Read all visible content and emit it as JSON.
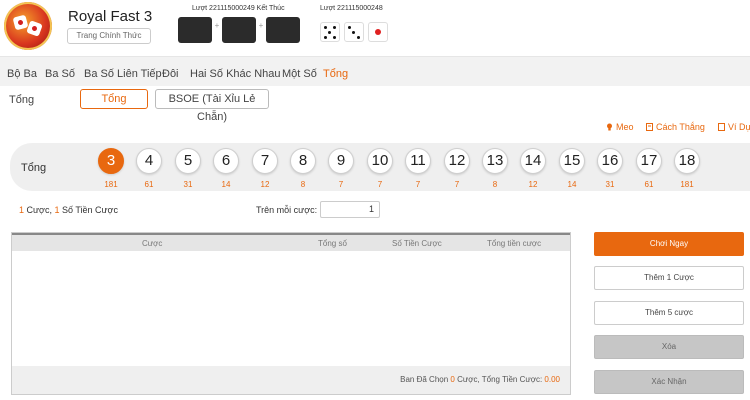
{
  "header": {
    "title": "Royal Fast 3",
    "home_button": "Trang Chính Thức",
    "result_label": "Lượt 221115000249 Kết Thúc",
    "next_label": "Lượt 221115000248",
    "logo_icon": "dice-logo-icon"
  },
  "tabs": [
    "Bộ Ba",
    "Ba Số",
    "Ba Số Liên Tiếp",
    "Đôi",
    "Hai Số Khác Nhau",
    "Một Số",
    "Tổng"
  ],
  "active_tab": "Tổng",
  "sub": {
    "label": "Tổng",
    "options": [
      "Tổng",
      "BSOE (Tài Xỉu Lẻ Chẵn)"
    ],
    "active": "Tổng"
  },
  "info_links": [
    "Meo",
    "Cách Thắng",
    "Ví Dụ"
  ],
  "numbers": {
    "label": "Tổng",
    "balls": [
      {
        "value": "3",
        "odds": "181"
      },
      {
        "value": "4",
        "odds": "61"
      },
      {
        "value": "5",
        "odds": "31"
      },
      {
        "value": "6",
        "odds": "14"
      },
      {
        "value": "7",
        "odds": "12"
      },
      {
        "value": "8",
        "odds": "8"
      },
      {
        "value": "9",
        "odds": "7"
      },
      {
        "value": "10",
        "odds": "7"
      },
      {
        "value": "11",
        "odds": "7"
      },
      {
        "value": "12",
        "odds": "7"
      },
      {
        "value": "13",
        "odds": "8"
      },
      {
        "value": "14",
        "odds": "12"
      },
      {
        "value": "15",
        "odds": "14"
      },
      {
        "value": "16",
        "odds": "31"
      },
      {
        "value": "17",
        "odds": "61"
      },
      {
        "value": "18",
        "odds": "181"
      }
    ],
    "selected": "3"
  },
  "bet_summary": {
    "count": "1",
    "count_text": "Cược,",
    "amount": "1",
    "amount_text": "Số Tiền Cược"
  },
  "per_bet": {
    "label": "Trên mỗi cược:",
    "value": "1"
  },
  "table": {
    "columns": [
      "Cược",
      "Tổng số",
      "Số Tiền Cược",
      "Tổng tiền cược"
    ],
    "rows": [],
    "footer_prefix": "Ban Đã Chọn",
    "footer_count": "0",
    "footer_mid": "Cược, Tổng Tiền Cược:",
    "footer_total": "0.00"
  },
  "actions": {
    "play_now": "Chơi Ngay",
    "add_one": "Thêm 1 Cược",
    "add_five": "Thêm 5 cược",
    "clear": "Xóa",
    "confirm": "Xác Nhận"
  },
  "colors": {
    "accent": "#e8680f",
    "panel": "#efefef",
    "result_box": "#2b2b2b"
  }
}
